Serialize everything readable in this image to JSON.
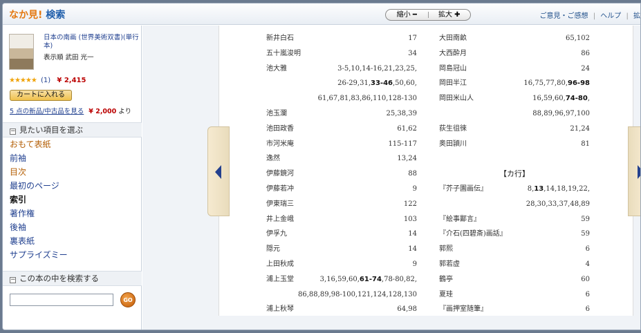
{
  "header": {
    "brand_orange": "なか見!",
    "brand_blue": "検索",
    "zoom_out": "縮小 ━",
    "zoom_in": "拡大 ✚",
    "links": [
      "ご意見・ご感想",
      "ヘルプ",
      "拡"
    ]
  },
  "book": {
    "title": "日本の南画 (世界美術双書)(単行本)",
    "author": "表示順 武田 光一",
    "stars": "★★★★★",
    "rating_count": "(1)",
    "price": "¥ 2,415",
    "cart_label": "カートに入れる",
    "used_link": "5 点の新品/中古品を見る",
    "used_price": "¥ 2,000",
    "used_suffix": "より"
  },
  "sections": {
    "browse_title": "見たい項目を選ぶ",
    "search_title": "この本の中を検索する",
    "collapse": "«",
    "go": "GO",
    "search_placeholder": ""
  },
  "nav": [
    {
      "label": "おもて表紙",
      "color": "#b45f06",
      "bold": false
    },
    {
      "label": "前袖",
      "color": "#1f3f8f",
      "bold": false
    },
    {
      "label": "目次",
      "color": "#b45f06",
      "bold": false
    },
    {
      "label": "最初のページ",
      "color": "#1f3f8f",
      "bold": false
    },
    {
      "label": "索引",
      "color": "#111111",
      "bold": true
    },
    {
      "label": "著作権",
      "color": "#1f3f8f",
      "bold": false
    },
    {
      "label": "後袖",
      "color": "#1f3f8f",
      "bold": false
    },
    {
      "label": "裏表紙",
      "color": "#1f3f8f",
      "bold": false
    },
    {
      "label": "サプライズミー",
      "color": "#1f3f8f",
      "bold": false
    }
  ],
  "index_left": [
    {
      "name": "新井白石",
      "pages": "17"
    },
    {
      "name": "五十嵐浚明",
      "pages": "34"
    },
    {
      "name": "池大雅",
      "pages": "3-5,10,14-16,21,23,25,"
    },
    {
      "name": "",
      "pages_pre": "26-29,31,",
      "pages_bold": "33-46",
      "pages_post": ",50,60,"
    },
    {
      "name": "",
      "pages": "61,67,81,83,86,110,128-130"
    },
    {
      "name": "池玉瀾",
      "pages": "25,38,39"
    },
    {
      "name": "池田政香",
      "pages": "61,62"
    },
    {
      "name": "市河米庵",
      "pages": "115-117"
    },
    {
      "name": "逸然",
      "pages": "13,24"
    },
    {
      "name": "伊藤鏡河",
      "pages": "88"
    },
    {
      "name": "伊藤若冲",
      "pages": "9"
    },
    {
      "name": "伊東瑞三",
      "pages": "122"
    },
    {
      "name": "井上金峨",
      "pages": "103"
    },
    {
      "name": "伊孚九",
      "pages": "14"
    },
    {
      "name": "隠元",
      "pages": "14"
    },
    {
      "name": "上田秋成",
      "pages": "9"
    },
    {
      "name": "浦上玉堂",
      "pages_pre": "3,16,59,60,",
      "pages_bold": "61-74",
      "pages_post": ",78-80,82,"
    },
    {
      "name": "",
      "pages": "86,88,89,98-100,121,124,128,130"
    },
    {
      "name": "浦上秋琴",
      "pages": "64,98"
    }
  ],
  "index_right": [
    {
      "name": "大田南畝",
      "pages": "65,102"
    },
    {
      "name": "大西酔月",
      "pages": "86"
    },
    {
      "name": "岡島冠山",
      "pages": "24"
    },
    {
      "name": "岡田半江",
      "pages_pre": "16,75,77,80,",
      "pages_bold": "96-98",
      "pages_post": ""
    },
    {
      "name": "岡田米山人",
      "pages_pre": "16,59,60,",
      "pages_bold": "74-80",
      "pages_post": ","
    },
    {
      "name": "",
      "pages": "88,89,96,97,100"
    },
    {
      "name": "荻生徂徠",
      "pages": "21,24"
    },
    {
      "name": "奥田頴川",
      "pages": "81"
    },
    {
      "name": "",
      "pages": ""
    },
    {
      "heading": "【カ行】"
    },
    {
      "name": "『芥子園画伝』",
      "pages_pre": "8,",
      "pages_bold": "13",
      "pages_post": ",14,18,19,22,"
    },
    {
      "name": "",
      "pages": "28,30,33,37,48,89"
    },
    {
      "name": "『絵事鄙言』",
      "pages": "59"
    },
    {
      "name": "『介石(四碧斎)画話』",
      "pages": "59"
    },
    {
      "name": "郭熙",
      "pages": "6"
    },
    {
      "name": "郭若虚",
      "pages": "4"
    },
    {
      "name": "鶴亭",
      "pages": "60"
    },
    {
      "name": "夏珪",
      "pages": "6"
    },
    {
      "name": "『画押室随筆』",
      "pages": "6"
    }
  ]
}
